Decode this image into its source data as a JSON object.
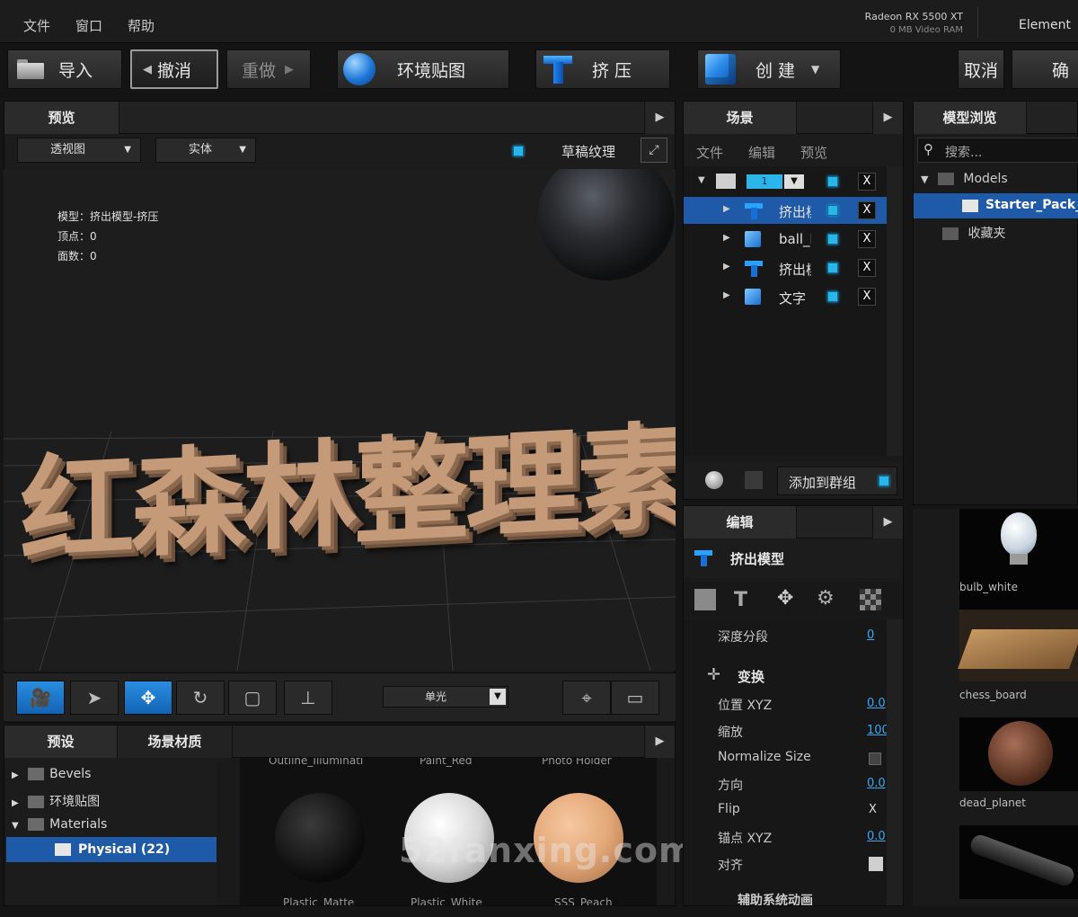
{
  "menu": {
    "file": "文件",
    "window": "窗口",
    "help": "帮助",
    "gpu_name": "Radeon RX 5500 XT",
    "gpu_ram": "0 MB Video RAM",
    "element": "Element"
  },
  "toolbar": {
    "import": "导入",
    "undo": "撤消",
    "redo": "重做",
    "env_map": "环境贴图",
    "extrude": "挤 压",
    "create": "创 建",
    "cancel": "取消",
    "confirm": "确"
  },
  "preview_panel": {
    "tab": "预览",
    "view_mode": "透视图",
    "shading": "实体",
    "draft_texture": "草稿纹理",
    "stats": {
      "model_label": "模型：",
      "model_value": "挤出模型-挤压",
      "vertices_label": "顶点：",
      "vertices_value": "0",
      "faces_label": "面数：",
      "faces_value": "0"
    },
    "extruded_text": "红森林整理素",
    "light_mode": "单光"
  },
  "scene_panel": {
    "tab": "场景",
    "menu": [
      "文件",
      "编辑",
      "预览"
    ],
    "group_number": "1",
    "items": [
      {
        "name": "挤出模型",
        "selected": true
      },
      {
        "name": "ball_blue",
        "selected": false
      },
      {
        "name": "挤出模型",
        "selected": false
      },
      {
        "name": "文字",
        "selected": false
      }
    ],
    "x_label": "X",
    "add_to_group": "添加到群组"
  },
  "edit_panel": {
    "tab": "编辑",
    "title": "挤出模型",
    "depth_segments_label": "深度分段",
    "depth_segments_value": "0",
    "transform_label": "变换",
    "position_label": "位置 XYZ",
    "position_value": "0.0",
    "scale_label": "缩放",
    "scale_value": "100",
    "normalize_label": "Normalize Size",
    "orientation_label": "方向",
    "orientation_value": "0.0",
    "flip_label": "Flip",
    "flip_value": "X",
    "anchor_label": "锚点 XYZ",
    "anchor_value": "0.0",
    "align_label": "对齐",
    "bottom_section": "辅助系统动画"
  },
  "model_browser": {
    "tab": "模型浏览",
    "search_placeholder": "搜索...",
    "tree": {
      "models": "Models",
      "starter_pack": "Starter_Pack_",
      "favorites": "收藏夹"
    },
    "thumbs": [
      "bulb_white",
      "chess_board",
      "dead_planet"
    ]
  },
  "presets_panel": {
    "tab_presets": "预设",
    "tab_materials": "场景材质",
    "tree": {
      "bevels": "Bevels",
      "env_maps": "环境贴图",
      "materials": "Materials",
      "physical": "Physical (22)"
    },
    "top_labels": [
      "Outline_Illuminati",
      "Paint_Red",
      "Photo Holder"
    ],
    "bottom_labels": [
      "Plastic_Matte",
      "Plastic_White",
      "SSS_Peach"
    ]
  },
  "watermark": "52fanxing.com",
  "colors": {
    "accent_blue": "#1f5aa8",
    "checkbox_cyan": "#2ab6ea",
    "text_orange": "#c49a78"
  }
}
